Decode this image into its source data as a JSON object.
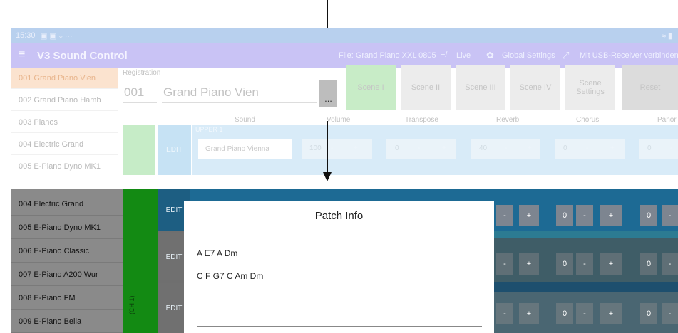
{
  "app": {
    "status_time": "15:30",
    "status_icons": "▣ ▣ ⤓ ···",
    "title": "V3 Sound Control",
    "file_label": "File: Grand Piano XXL 0805",
    "live_label": "Live",
    "global_settings_label": "Global Settings",
    "usb_label": "Mit USB-Receiver verbinden"
  },
  "upper": {
    "sidebar": [
      {
        "label": "001 Grand Piano Vien"
      },
      {
        "label": "002 Grand Piano Hamb"
      },
      {
        "label": "003 Pianos"
      },
      {
        "label": "004 Electric Grand"
      },
      {
        "label": "005 E-Piano Dyno MK1"
      }
    ],
    "registration_label": "Registration",
    "registration_number": "001",
    "registration_name": "Grand Piano Vien",
    "more_button": "...",
    "scenes": [
      "Scene I",
      "Scene II",
      "Scene III",
      "Scene IV",
      "Scene Settings",
      "Reset"
    ],
    "columns": [
      "Sound",
      "Volume",
      "Transpose",
      "Reverb",
      "Chorus",
      "Panor"
    ],
    "row": {
      "edit": "EDIT",
      "label": "UPPER 1",
      "sound": "Grand Piano Vienna",
      "volume": "100",
      "transpose": "0",
      "reverb": "40",
      "chorus": "0",
      "pan": "0",
      "minus": "-",
      "plus": "+"
    }
  },
  "lower": {
    "sidebar": [
      {
        "label": "004 Electric Grand"
      },
      {
        "label": "005 E-Piano Dyno MK1"
      },
      {
        "label": "006 E-Piano Classic"
      },
      {
        "label": "007 E-Piano A200 Wur"
      },
      {
        "label": "008 E-Piano FM"
      },
      {
        "label": "009 E-Piano Bella"
      }
    ],
    "channel_label": "(CH 1)",
    "edit": "EDIT",
    "zero": "0",
    "minus": "-",
    "plus": "+"
  },
  "dialog": {
    "title": "Patch Info",
    "line1": "A E7 A Dm",
    "line2": "C F G7 C Am Dm"
  },
  "colors": {
    "accent_purple": "#c9c3f5",
    "scene_active": "#c8ecc7",
    "selected_row": "#fbe3cf",
    "channel_green": "#138a13",
    "edit_blue": "#1d5e82"
  }
}
